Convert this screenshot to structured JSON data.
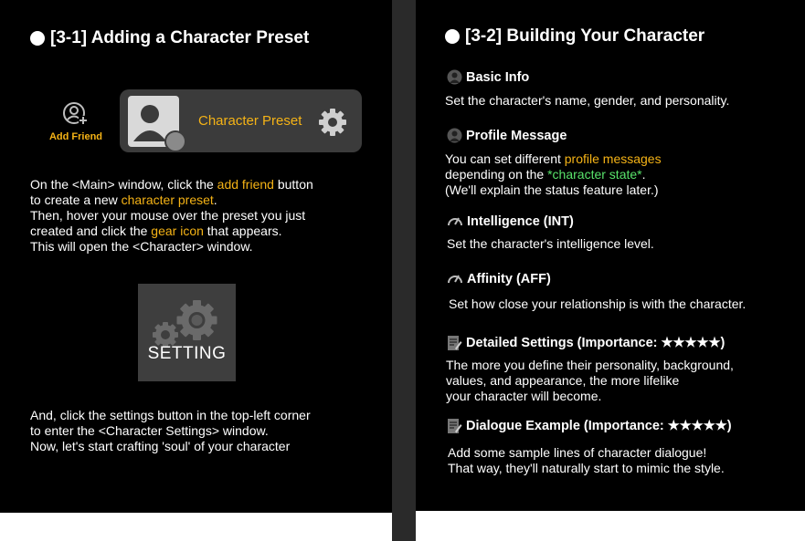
{
  "left": {
    "heading": "[3-1] Adding a Character Preset",
    "add_friend_label": "Add Friend",
    "preset_label": "Character Preset",
    "para1": {
      "l1a": "On the <Main> window, click the ",
      "l1b": "add friend",
      "l1c": " button",
      "l2a": "to create a new ",
      "l2b": "character preset",
      "l2c": ".",
      "l3": "Then, hover your mouse over the preset you just",
      "l4a": "created and click the ",
      "l4b": "gear icon",
      "l4c": " that appears.",
      "l5": "This will open the <Character> window."
    },
    "setting_label": "SETTING",
    "para2": {
      "l1": "And, click the settings button in the top-left corner",
      "l2": "to enter the <Character Settings> window.",
      "l3": "Now, let's start crafting 'soul' of your character"
    }
  },
  "right": {
    "heading": "[3-2] Building Your Character",
    "basic_info": {
      "title": "Basic Info",
      "text": "Set the character's name, gender, and personality."
    },
    "profile_message": {
      "title": "Profile Message",
      "l1a": "You can set different ",
      "l1b": "profile messages",
      "l2a": "depending on the ",
      "l2b": "*character state*",
      "l2c": ".",
      "l3": "(We'll explain the status feature later.)"
    },
    "intelligence": {
      "title": "Intelligence (INT)",
      "text": "Set the character's intelligence level."
    },
    "affinity": {
      "title": "Affinity (AFF)",
      "text": "Set how close your relationship is with the character."
    },
    "detailed_settings": {
      "title": "Detailed Settings (Importance: ★★★★★)",
      "l1": "The more you define their personality, background,",
      "l2": "values, and appearance, the more lifelike",
      "l3": "your character will become."
    },
    "dialogue_example": {
      "title": "Dialogue Example (Importance: ★★★★★)",
      "l1": "Add some sample lines of character dialogue!",
      "l2": "That way, they'll naturally start to mimic the style."
    }
  },
  "colors": {
    "accent": "#f5b316",
    "green": "#59e36b",
    "background": "#000000",
    "divider": "#2a2a2a"
  },
  "icons": [
    "add-friend-icon",
    "avatar-icon",
    "gear-icon",
    "settings-gears-icon",
    "user-icon",
    "gauge-icon",
    "notepad-icon"
  ]
}
